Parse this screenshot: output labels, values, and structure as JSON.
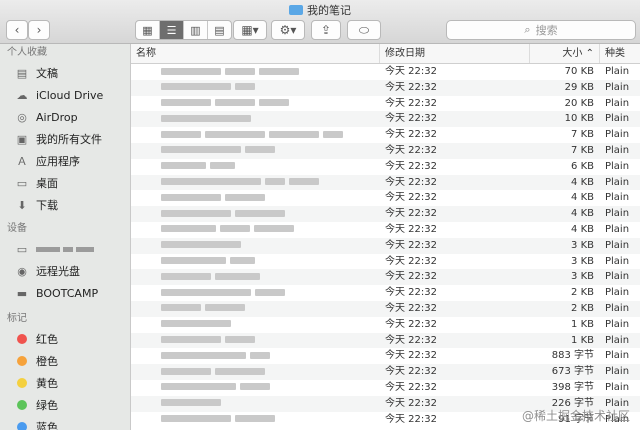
{
  "window": {
    "title": "我的笔记"
  },
  "toolbar": {
    "back": "‹",
    "forward": "›",
    "search_placeholder": "搜索"
  },
  "sidebar": {
    "favorites_header": "个人收藏",
    "favorites": [
      {
        "label": "文稿",
        "icon": "document-icon"
      },
      {
        "label": "iCloud Drive",
        "icon": "cloud-icon"
      },
      {
        "label": "AirDrop",
        "icon": "airdrop-icon"
      },
      {
        "label": "我的所有文件",
        "icon": "all-files-icon"
      },
      {
        "label": "应用程序",
        "icon": "applications-icon"
      },
      {
        "label": "桌面",
        "icon": "desktop-icon"
      },
      {
        "label": "下载",
        "icon": "download-icon"
      }
    ],
    "devices_header": "设备",
    "devices": [
      {
        "label": "远程光盘",
        "icon": "disc-icon"
      },
      {
        "label": "BOOTCAMP",
        "icon": "drive-icon"
      }
    ],
    "tags_header": "标记",
    "tags": [
      {
        "label": "红色",
        "color": "#f0534e"
      },
      {
        "label": "橙色",
        "color": "#f6a23b"
      },
      {
        "label": "黄色",
        "color": "#f4d03f"
      },
      {
        "label": "绿色",
        "color": "#5cc45a"
      },
      {
        "label": "蓝色",
        "color": "#4a9bef"
      }
    ]
  },
  "columns": {
    "name": "名称",
    "date": "修改日期",
    "size": "大小",
    "kind": "种类"
  },
  "files": [
    {
      "date": "今天 22:32",
      "size": "70 KB",
      "kind": "Plain"
    },
    {
      "date": "今天 22:32",
      "size": "29 KB",
      "kind": "Plain"
    },
    {
      "date": "今天 22:32",
      "size": "20 KB",
      "kind": "Plain"
    },
    {
      "date": "今天 22:32",
      "size": "10 KB",
      "kind": "Plain"
    },
    {
      "date": "今天 22:32",
      "size": "7 KB",
      "kind": "Plain"
    },
    {
      "date": "今天 22:32",
      "size": "7 KB",
      "kind": "Plain"
    },
    {
      "date": "今天 22:32",
      "size": "6 KB",
      "kind": "Plain"
    },
    {
      "date": "今天 22:32",
      "size": "4 KB",
      "kind": "Plain"
    },
    {
      "date": "今天 22:32",
      "size": "4 KB",
      "kind": "Plain"
    },
    {
      "date": "今天 22:32",
      "size": "4 KB",
      "kind": "Plain"
    },
    {
      "date": "今天 22:32",
      "size": "4 KB",
      "kind": "Plain"
    },
    {
      "date": "今天 22:32",
      "size": "3 KB",
      "kind": "Plain"
    },
    {
      "date": "今天 22:32",
      "size": "3 KB",
      "kind": "Plain"
    },
    {
      "date": "今天 22:32",
      "size": "3 KB",
      "kind": "Plain"
    },
    {
      "date": "今天 22:32",
      "size": "2 KB",
      "kind": "Plain"
    },
    {
      "date": "今天 22:32",
      "size": "2 KB",
      "kind": "Plain"
    },
    {
      "date": "今天 22:32",
      "size": "1 KB",
      "kind": "Plain"
    },
    {
      "date": "今天 22:32",
      "size": "1 KB",
      "kind": "Plain"
    },
    {
      "date": "今天 22:32",
      "size": "883 字节",
      "kind": "Plain"
    },
    {
      "date": "今天 22:32",
      "size": "673 字节",
      "kind": "Plain"
    },
    {
      "date": "今天 22:32",
      "size": "398 字节",
      "kind": "Plain"
    },
    {
      "date": "今天 22:32",
      "size": "226 字节",
      "kind": "Plain"
    },
    {
      "date": "今天 22:32",
      "size": "91 字节",
      "kind": "Plain"
    }
  ],
  "watermark": "@稀土掘金技术社区"
}
